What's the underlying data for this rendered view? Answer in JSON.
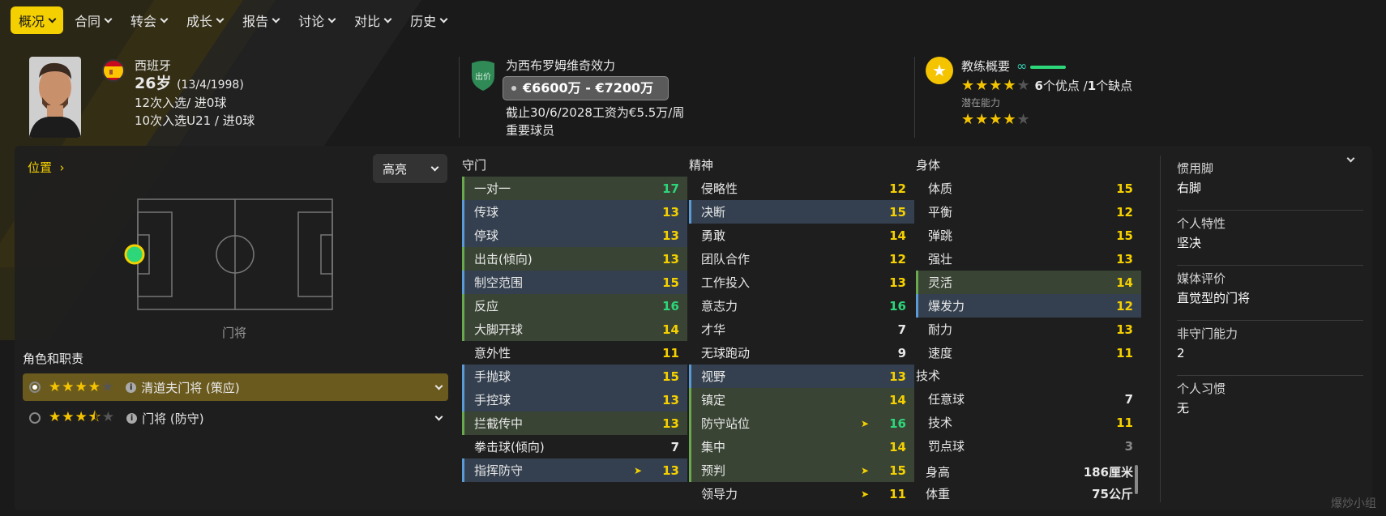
{
  "nav": {
    "items": [
      {
        "label": "概况",
        "active": true
      },
      {
        "label": "合同"
      },
      {
        "label": "转会"
      },
      {
        "label": "成长"
      },
      {
        "label": "报告"
      },
      {
        "label": "讨论"
      },
      {
        "label": "对比"
      },
      {
        "label": "历史"
      }
    ]
  },
  "player": {
    "nation": "西班牙",
    "age": "26岁",
    "dob": "(13/4/1998)",
    "caps": "12次入选/ 进0球",
    "u21_caps": "10次入选U21 / 进0球"
  },
  "club": {
    "badge_label": "出价",
    "plays_for": "为西布罗姆维奇效力",
    "value": "€6600万 - €7200万",
    "contract": "截止30/6/2028工资为€5.5万/周",
    "status": "重要球员"
  },
  "coach": {
    "title": "教练概要",
    "current_stars": 4,
    "summary_pros": "6",
    "summary_pros_label": "个优点 /",
    "summary_cons": "1",
    "summary_cons_label": "个缺点",
    "potential_label": "潜在能力",
    "potential_stars": 4
  },
  "position": {
    "link": "位置",
    "highlight_button": "高亮",
    "label": "门将"
  },
  "roles": {
    "title": "角色和职责",
    "items": [
      {
        "name": "清道夫门将 (策应)",
        "stars": "4",
        "selected": true
      },
      {
        "name": "门将 (防守)",
        "stars": "3.5",
        "selected": false
      }
    ]
  },
  "columns": {
    "gk": {
      "title": "守门",
      "attrs": [
        {
          "name": "一对一",
          "val": "17",
          "hl": "g",
          "c": "v-g"
        },
        {
          "name": "传球",
          "val": "13",
          "hl": "b",
          "c": "v-y"
        },
        {
          "name": "停球",
          "val": "13",
          "hl": "b",
          "c": "v-y"
        },
        {
          "name": "出击(倾向)",
          "val": "13",
          "hl": "g",
          "c": "v-y"
        },
        {
          "name": "制空范围",
          "val": "15",
          "hl": "b",
          "c": "v-y"
        },
        {
          "name": "反应",
          "val": "16",
          "hl": "g",
          "c": "v-g"
        },
        {
          "name": "大脚开球",
          "val": "14",
          "hl": "g",
          "c": "v-y"
        },
        {
          "name": "意外性",
          "val": "11",
          "hl": "",
          "c": "v-y"
        },
        {
          "name": "手抛球",
          "val": "15",
          "hl": "b",
          "c": "v-y"
        },
        {
          "name": "手控球",
          "val": "13",
          "hl": "b",
          "c": "v-y"
        },
        {
          "name": "拦截传中",
          "val": "13",
          "hl": "g",
          "c": "v-y"
        },
        {
          "name": "拳击球(倾向)",
          "val": "7",
          "hl": "",
          "c": "v-w"
        },
        {
          "name": "指挥防守",
          "val": "13",
          "hl": "b",
          "c": "v-y",
          "flair": true
        }
      ]
    },
    "mental": {
      "title": "精神",
      "attrs": [
        {
          "name": "侵略性",
          "val": "12",
          "hl": "",
          "c": "v-y"
        },
        {
          "name": "决断",
          "val": "15",
          "hl": "b",
          "c": "v-y"
        },
        {
          "name": "勇敢",
          "val": "14",
          "hl": "",
          "c": "v-y"
        },
        {
          "name": "团队合作",
          "val": "12",
          "hl": "",
          "c": "v-y"
        },
        {
          "name": "工作投入",
          "val": "13",
          "hl": "",
          "c": "v-y"
        },
        {
          "name": "意志力",
          "val": "16",
          "hl": "",
          "c": "v-g"
        },
        {
          "name": "才华",
          "val": "7",
          "hl": "",
          "c": "v-w"
        },
        {
          "name": "无球跑动",
          "val": "9",
          "hl": "",
          "c": "v-w"
        },
        {
          "name": "视野",
          "val": "13",
          "hl": "b",
          "c": "v-y"
        },
        {
          "name": "镇定",
          "val": "14",
          "hl": "g",
          "c": "v-y"
        },
        {
          "name": "防守站位",
          "val": "16",
          "hl": "g",
          "c": "v-g",
          "flair": true
        },
        {
          "name": "集中",
          "val": "14",
          "hl": "g",
          "c": "v-y"
        },
        {
          "name": "预判",
          "val": "15",
          "hl": "g",
          "c": "v-y",
          "flair": true
        },
        {
          "name": "领导力",
          "val": "11",
          "hl": "",
          "c": "v-y",
          "flair": true
        }
      ]
    },
    "physical": {
      "title": "身体",
      "attrs": [
        {
          "name": "体质",
          "val": "15",
          "hl": "",
          "c": "v-y"
        },
        {
          "name": "平衡",
          "val": "12",
          "hl": "",
          "c": "v-y"
        },
        {
          "name": "弹跳",
          "val": "15",
          "hl": "",
          "c": "v-y"
        },
        {
          "name": "强壮",
          "val": "13",
          "hl": "",
          "c": "v-y"
        },
        {
          "name": "灵活",
          "val": "14",
          "hl": "g",
          "c": "v-y"
        },
        {
          "name": "爆发力",
          "val": "12",
          "hl": "b",
          "c": "v-y"
        },
        {
          "name": "耐力",
          "val": "13",
          "hl": "",
          "c": "v-y"
        },
        {
          "name": "速度",
          "val": "11",
          "hl": "",
          "c": "v-y"
        }
      ]
    },
    "technical": {
      "title": "技术",
      "attrs": [
        {
          "name": "任意球",
          "val": "7",
          "hl": "",
          "c": "v-w"
        },
        {
          "name": "技术",
          "val": "11",
          "hl": "",
          "c": "v-y"
        },
        {
          "name": "罚点球",
          "val": "3",
          "hl": "",
          "c": "v-d"
        }
      ]
    },
    "body": [
      {
        "name": "身高",
        "val": "186厘米"
      },
      {
        "name": "体重",
        "val": "75公斤"
      }
    ]
  },
  "right_info": [
    {
      "label": "惯用脚",
      "value": "右脚",
      "dropdown": true
    },
    {
      "label": "个人特性",
      "value": "坚决"
    },
    {
      "label": "媒体评价",
      "value": "直觉型的门将"
    },
    {
      "label": "非守门能力",
      "value": "2"
    },
    {
      "label": "个人习惯",
      "value": "无"
    }
  ],
  "watermark": "爆炒小组",
  "colors": {
    "accent": "#f5d000",
    "green_val": "#2ed67a",
    "gk_highlight": "#394434",
    "blue_highlight": "#34404f"
  }
}
